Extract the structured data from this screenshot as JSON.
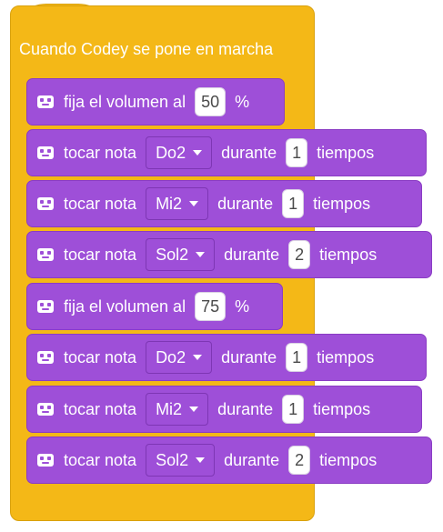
{
  "hat": {
    "title": "Cuando Codey se pone en marcha"
  },
  "icons": {
    "block_icon": "codey-robot-icon",
    "dropdown_arrow": "caret-down-icon"
  },
  "colors": {
    "hat": "#F4B817",
    "block": "#9E4FD8",
    "text": "#ffffff",
    "input_bg": "#ffffff"
  },
  "blocks": [
    {
      "type": "volume",
      "label": "fija el volumen al",
      "value": "50",
      "unit": "%"
    },
    {
      "type": "note",
      "label": "tocar nota",
      "note": "Do2",
      "during": "durante",
      "beats": "1",
      "unit": "tiempos"
    },
    {
      "type": "note",
      "label": "tocar nota",
      "note": "Mi2",
      "during": "durante",
      "beats": "1",
      "unit": "tiempos"
    },
    {
      "type": "note",
      "label": "tocar nota",
      "note": "Sol2",
      "during": "durante",
      "beats": "2",
      "unit": "tiempos"
    },
    {
      "type": "volume",
      "label": "fija el volumen al",
      "value": "75",
      "unit": "%"
    },
    {
      "type": "note",
      "label": "tocar nota",
      "note": "Do2",
      "during": "durante",
      "beats": "1",
      "unit": "tiempos"
    },
    {
      "type": "note",
      "label": "tocar nota",
      "note": "Mi2",
      "during": "durante",
      "beats": "1",
      "unit": "tiempos"
    },
    {
      "type": "note",
      "label": "tocar nota",
      "note": "Sol2",
      "during": "durante",
      "beats": "2",
      "unit": "tiempos"
    }
  ]
}
